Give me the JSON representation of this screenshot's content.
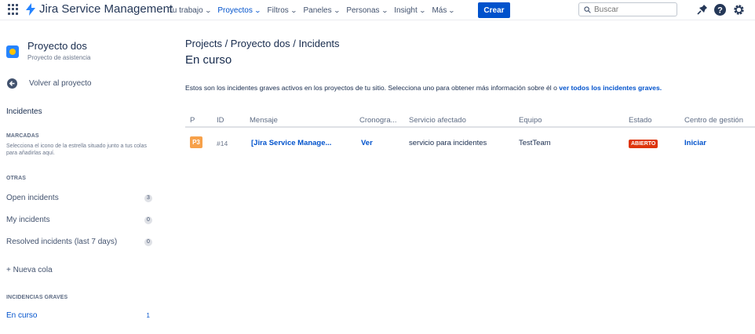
{
  "topnav": {
    "product": "Jira Service Management",
    "items": [
      {
        "label": "Tu trabajo",
        "active": false
      },
      {
        "label": "Proyectos",
        "active": true
      },
      {
        "label": "Filtros",
        "active": false
      },
      {
        "label": "Paneles",
        "active": false
      },
      {
        "label": "Personas",
        "active": false
      },
      {
        "label": "Insight",
        "active": false
      },
      {
        "label": "Más",
        "active": false
      }
    ],
    "create_label": "Crear",
    "search_placeholder": "Buscar",
    "icons": [
      "app-switcher-icon",
      "jira-logo-icon",
      "notifications-icon",
      "help-icon",
      "settings-icon"
    ],
    "brand_color": "#0052cc"
  },
  "sidebar": {
    "project_name": "Proyecto dos",
    "project_type": "Proyecto de asistencia",
    "back_label": "Volver al proyecto",
    "incidents_heading": "Incidentes",
    "marked_title": "MARCADAS",
    "marked_desc": "Selecciona el icono de la estrella situado junto a tus colas para añadirlas aquí.",
    "other_title": "OTRAS",
    "queues": [
      {
        "label": "Open incidents",
        "count": "3"
      },
      {
        "label": "My incidents",
        "count": "0"
      },
      {
        "label": "Resolved incidents (last 7 days)",
        "count": "0"
      }
    ],
    "new_queue": "+ Nueva cola",
    "major_title": "INCIDENCIAS GRAVES",
    "major_items": [
      {
        "label": "En curso",
        "count": "1",
        "active": true
      }
    ]
  },
  "main": {
    "breadcrumb": "Projects / Proyecto dos / Incidents",
    "title": "En curso",
    "intro_text": "Estos son los incidentes graves activos en los proyectos de tu sitio. Selecciona uno para obtener más información sobre él o ",
    "intro_link": "ver todos los incidentes graves.",
    "columns": [
      "P",
      "ID",
      "Mensaje",
      "Cronogra...",
      "Servicio afectado",
      "Equipo",
      "Estado",
      "Centro de gestión"
    ],
    "rows": [
      {
        "priority": "P3",
        "id": "#14",
        "message": "[Jira Service Manage...",
        "timeline": "Ver",
        "service": "servicio para incidentes",
        "team": "TestTeam",
        "status": "ABIERTO",
        "action": "Iniciar"
      }
    ],
    "priority_color": "#f7a14a",
    "status_color": "#de350b"
  }
}
